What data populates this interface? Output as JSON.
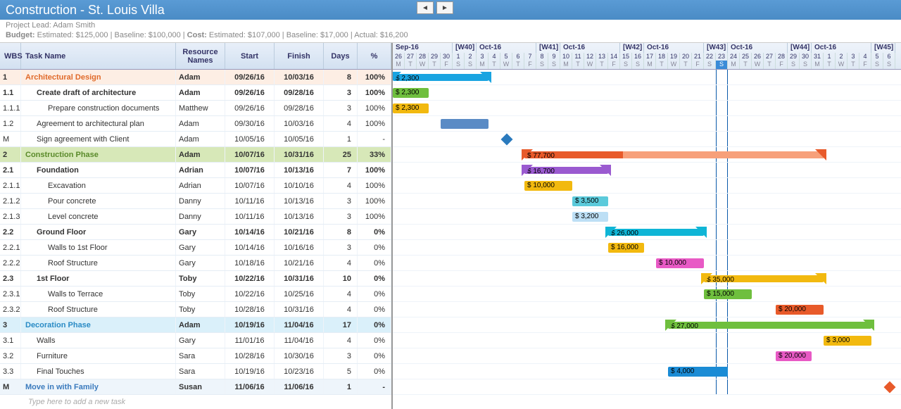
{
  "header": {
    "title": "Construction - St. Louis Villa"
  },
  "info": {
    "lead_label": "Project Lead:",
    "lead": "Adam Smith",
    "budget_label": "Budget:",
    "budget_est": "Estimated: $125,000",
    "budget_base": "Baseline: $100,000",
    "cost_label": "Cost:",
    "cost_est": "Estimated: $107,000",
    "cost_base": "Baseline: $17,000",
    "cost_act": "Actual: $16,200"
  },
  "columns": {
    "wbs": "WBS",
    "name": "Task Name",
    "res": "Resource Names",
    "start": "Start",
    "finish": "Finish",
    "days": "Days",
    "pct": "%"
  },
  "placeholder": "Type here to add a new task",
  "timeline": {
    "start_date": "2016-09-26",
    "day_width": 17,
    "today_col": 27,
    "months": [
      {
        "label": "Sep-16",
        "days": 5,
        "wk": ""
      },
      {
        "label": "[W40]",
        "days": 2,
        "wk": "1"
      },
      {
        "label": "Oct-16",
        "days": 5,
        "wk": ""
      },
      {
        "label": "[W41]",
        "days": 2,
        "wk": "1"
      },
      {
        "label": "Oct-16",
        "days": 5,
        "wk": ""
      },
      {
        "label": "[W42]",
        "days": 2,
        "wk": "1"
      },
      {
        "label": "Oct-16",
        "days": 5,
        "wk": ""
      },
      {
        "label": "[W43]",
        "days": 2,
        "wk": "1"
      },
      {
        "label": "Oct-16",
        "days": 5,
        "wk": ""
      },
      {
        "label": "[W44]",
        "days": 2,
        "wk": "1"
      },
      {
        "label": "Oct-16",
        "days": 5,
        "wk": ""
      },
      {
        "label": "[W45]",
        "days": 2,
        "wk": "1"
      }
    ],
    "daynums": [
      26,
      27,
      28,
      29,
      30,
      1,
      2,
      3,
      4,
      5,
      6,
      7,
      8,
      9,
      10,
      11,
      12,
      13,
      14,
      15,
      16,
      17,
      18,
      19,
      20,
      21,
      22,
      23,
      24,
      25,
      26,
      27,
      28,
      29,
      30,
      31,
      1,
      2,
      3,
      4,
      5,
      6
    ],
    "dow": [
      "M",
      "T",
      "W",
      "T",
      "F",
      "S",
      "S",
      "M",
      "T",
      "W",
      "T",
      "F",
      "S",
      "S",
      "M",
      "T",
      "W",
      "T",
      "F",
      "S",
      "S",
      "M",
      "T",
      "W",
      "T",
      "F",
      "S",
      "S",
      "M",
      "T",
      "W",
      "T",
      "F",
      "S",
      "S",
      "M",
      "T",
      "W",
      "T",
      "F",
      "S",
      "S"
    ]
  },
  "rows": [
    {
      "wbs": "1",
      "name": "Architectural Design",
      "res": "Adam",
      "start": "09/26/16",
      "fin": "10/03/16",
      "days": "8",
      "pct": "100%",
      "cls": "summary-orange bold",
      "indent": 0,
      "bar": {
        "type": "sum",
        "col": 0,
        "span": 8,
        "label": "$ 2,300",
        "color": "#19a4e1"
      }
    },
    {
      "wbs": "1.1",
      "name": "Create draft of architecture",
      "res": "Adam",
      "start": "09/26/16",
      "fin": "09/28/16",
      "days": "3",
      "pct": "100%",
      "cls": "bold",
      "indent": 1,
      "bar": {
        "type": "bar",
        "col": 0,
        "span": 3,
        "label": "$ 2,300",
        "color": "#6fbf3e"
      }
    },
    {
      "wbs": "1.1.1",
      "name": "Prepare construction documents",
      "res": "Matthew",
      "start": "09/26/16",
      "fin": "09/28/16",
      "days": "3",
      "pct": "100%",
      "cls": "",
      "indent": 2,
      "bar": {
        "type": "bar",
        "col": 0,
        "span": 3,
        "label": "$ 2,300",
        "color": "#f2b90f"
      }
    },
    {
      "wbs": "1.2",
      "name": "Agreement to architectural plan",
      "res": "Adam",
      "start": "09/30/16",
      "fin": "10/03/16",
      "days": "4",
      "pct": "100%",
      "cls": "",
      "indent": 1,
      "bar": {
        "type": "bar",
        "col": 4,
        "span": 4,
        "label": "",
        "color": "#5a8bc5"
      }
    },
    {
      "wbs": "M",
      "name": "Sign agreement with Client",
      "res": "Adam",
      "start": "10/05/16",
      "fin": "10/05/16",
      "days": "1",
      "pct": "-",
      "cls": "",
      "indent": 1,
      "bar": {
        "type": "diamond",
        "col": 9,
        "color": "#2a7abd"
      }
    },
    {
      "wbs": "2",
      "name": "Construction Phase",
      "res": "Adam",
      "start": "10/07/16",
      "fin": "10/31/16",
      "days": "25",
      "pct": "33%",
      "cls": "summary-green bold",
      "indent": 0,
      "bar": {
        "type": "sum",
        "col": 11,
        "span": 25,
        "label": "$ 77,700",
        "color": "#e85a2a",
        "prog": 0.33,
        "progcolor": "#f7a07a"
      }
    },
    {
      "wbs": "2.1",
      "name": "Foundation",
      "res": "Adrian",
      "start": "10/07/16",
      "fin": "10/13/16",
      "days": "7",
      "pct": "100%",
      "cls": "bold",
      "indent": 1,
      "bar": {
        "type": "sum",
        "col": 11,
        "span": 7,
        "label": "$ 16,700",
        "color": "#9a5ad0"
      }
    },
    {
      "wbs": "2.1.1",
      "name": "Excavation",
      "res": "Adrian",
      "start": "10/07/16",
      "fin": "10/10/16",
      "days": "4",
      "pct": "100%",
      "cls": "",
      "indent": 2,
      "bar": {
        "type": "bar",
        "col": 11,
        "span": 4,
        "label": "$ 10,000",
        "color": "#f2b90f"
      }
    },
    {
      "wbs": "2.1.2",
      "name": "Pour concrete",
      "res": "Danny",
      "start": "10/11/16",
      "fin": "10/13/16",
      "days": "3",
      "pct": "100%",
      "cls": "",
      "indent": 2,
      "bar": {
        "type": "bar",
        "col": 15,
        "span": 3,
        "label": "$ 3,500",
        "color": "#5bcadb"
      }
    },
    {
      "wbs": "2.1.3",
      "name": "Level concrete",
      "res": "Danny",
      "start": "10/11/16",
      "fin": "10/13/16",
      "days": "3",
      "pct": "100%",
      "cls": "",
      "indent": 2,
      "bar": {
        "type": "bar",
        "col": 15,
        "span": 3,
        "label": "$ 3,200",
        "color": "#bddff5"
      }
    },
    {
      "wbs": "2.2",
      "name": "Ground Floor",
      "res": "Gary",
      "start": "10/14/16",
      "fin": "10/21/16",
      "days": "8",
      "pct": "0%",
      "cls": "bold",
      "indent": 1,
      "bar": {
        "type": "sum",
        "col": 18,
        "span": 8,
        "label": "$ 26,000",
        "color": "#0fb5d6"
      }
    },
    {
      "wbs": "2.2.1",
      "name": "Walls to 1st Floor",
      "res": "Gary",
      "start": "10/14/16",
      "fin": "10/16/16",
      "days": "3",
      "pct": "0%",
      "cls": "",
      "indent": 2,
      "bar": {
        "type": "bar",
        "col": 18,
        "span": 3,
        "label": "$ 16,000",
        "color": "#f2b90f"
      }
    },
    {
      "wbs": "2.2.2",
      "name": "Roof Structure",
      "res": "Gary",
      "start": "10/18/16",
      "fin": "10/21/16",
      "days": "4",
      "pct": "0%",
      "cls": "",
      "indent": 2,
      "bar": {
        "type": "bar",
        "col": 22,
        "span": 4,
        "label": "$ 10,000",
        "color": "#e85ac5"
      }
    },
    {
      "wbs": "2.3",
      "name": "1st Floor",
      "res": "Toby",
      "start": "10/22/16",
      "fin": "10/31/16",
      "days": "10",
      "pct": "0%",
      "cls": "bold",
      "indent": 1,
      "bar": {
        "type": "sum",
        "col": 26,
        "span": 10,
        "label": "$ 35,000",
        "color": "#f2b90f"
      }
    },
    {
      "wbs": "2.3.1",
      "name": "Walls to Terrace",
      "res": "Toby",
      "start": "10/22/16",
      "fin": "10/25/16",
      "days": "4",
      "pct": "0%",
      "cls": "",
      "indent": 2,
      "bar": {
        "type": "bar",
        "col": 26,
        "span": 4,
        "label": "$ 15,000",
        "color": "#6fbf3e"
      }
    },
    {
      "wbs": "2.3.2",
      "name": "Roof Structure",
      "res": "Toby",
      "start": "10/28/16",
      "fin": "10/31/16",
      "days": "4",
      "pct": "0%",
      "cls": "",
      "indent": 2,
      "bar": {
        "type": "bar",
        "col": 32,
        "span": 4,
        "label": "$ 20,000",
        "color": "#e85a2a"
      }
    },
    {
      "wbs": "3",
      "name": "Decoration Phase",
      "res": "Adam",
      "start": "10/19/16",
      "fin": "11/04/16",
      "days": "17",
      "pct": "0%",
      "cls": "summary-blue bold",
      "indent": 0,
      "bar": {
        "type": "sum",
        "col": 23,
        "span": 17,
        "label": "$ 27,000",
        "color": "#6fbf3e"
      }
    },
    {
      "wbs": "3.1",
      "name": "Walls",
      "res": "Gary",
      "start": "11/01/16",
      "fin": "11/04/16",
      "days": "4",
      "pct": "0%",
      "cls": "",
      "indent": 1,
      "bar": {
        "type": "bar",
        "col": 36,
        "span": 4,
        "label": "$ 3,000",
        "color": "#f2b90f"
      }
    },
    {
      "wbs": "3.2",
      "name": "Furniture",
      "res": "Sara",
      "start": "10/28/16",
      "fin": "10/30/16",
      "days": "3",
      "pct": "0%",
      "cls": "",
      "indent": 1,
      "bar": {
        "type": "bar",
        "col": 32,
        "span": 3,
        "label": "$ 20,000",
        "color": "#e85ac5"
      }
    },
    {
      "wbs": "3.3",
      "name": "Final Touches",
      "res": "Sara",
      "start": "10/19/16",
      "fin": "10/23/16",
      "days": "5",
      "pct": "0%",
      "cls": "",
      "indent": 1,
      "bar": {
        "type": "bar",
        "col": 23,
        "span": 5,
        "label": "$ 4,000",
        "color": "#1a8bd5"
      }
    },
    {
      "wbs": "M",
      "name": "Move in with Family",
      "res": "Susan",
      "start": "11/06/16",
      "fin": "11/06/16",
      "days": "1",
      "pct": "-",
      "cls": "milestone bold",
      "indent": 0,
      "bar": {
        "type": "diamond",
        "col": 41,
        "color": "#e85a2a"
      }
    }
  ]
}
